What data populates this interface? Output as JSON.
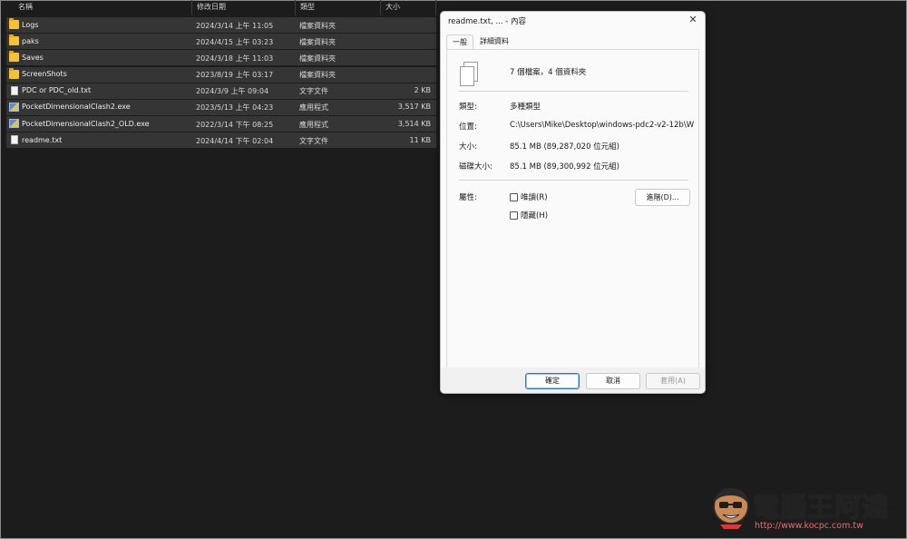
{
  "explorer": {
    "columns": {
      "name": "名稱",
      "date": "修改日期",
      "type": "類型",
      "size": "大小"
    },
    "files": [
      {
        "icon": "folder-icon",
        "name": "Logs",
        "date": "2024/3/14 上午 11:05",
        "type": "檔案資料夾",
        "size": ""
      },
      {
        "icon": "folder-icon",
        "name": "paks",
        "date": "2024/4/15 上午 03:23",
        "type": "檔案資料夾",
        "size": ""
      },
      {
        "icon": "folder-icon",
        "name": "Saves",
        "date": "2024/3/18 上午 11:03",
        "type": "檔案資料夾",
        "size": ""
      },
      {
        "icon": "folder-icon",
        "name": "ScreenShots",
        "date": "2023/8/19 上午 03:17",
        "type": "檔案資料夾",
        "size": ""
      },
      {
        "icon": "text-file-icon",
        "name": "PDC or PDC_old.txt",
        "date": "2024/3/9 上午 09:04",
        "type": "文字文件",
        "size": "2 KB"
      },
      {
        "icon": "exe-icon",
        "name": "PocketDimensionalClash2.exe",
        "date": "2023/5/13 上午 04:23",
        "type": "應用程式",
        "size": "3,517 KB"
      },
      {
        "icon": "exe-icon",
        "name": "PocketDimensionalClash2_OLD.exe",
        "date": "2022/3/14 下午 08:25",
        "type": "應用程式",
        "size": "3,514 KB"
      },
      {
        "icon": "text-file-icon",
        "name": "readme.txt",
        "date": "2024/4/14 下午 02:04",
        "type": "文字文件",
        "size": "11 KB"
      }
    ]
  },
  "dialog": {
    "title": "readme.txt, ... - 內容",
    "close": "✕",
    "tabs": [
      "一般",
      "詳細資料"
    ],
    "summary": "7 個檔案，4 個資料夾",
    "type_label": "類型:",
    "type_value": "多種類型",
    "location_label": "位置:",
    "location_value": "C:\\Users\\Mike\\Desktop\\windows-pdc2-v2-12b\\W",
    "size_label": "大小:",
    "size_value": "85.1 MB (89,287,020 位元組)",
    "disk_size_label": "磁碟大小:",
    "disk_size_value": "85.1 MB (89,300,992 位元組)",
    "attributes_label": "屬性:",
    "readonly_label": "唯讀(R)",
    "hidden_label": "隱藏(H)",
    "advanced_button": "進階(D)...",
    "ok_button": "確定",
    "cancel_button": "取消",
    "apply_button": "套用(A)"
  },
  "watermark": {
    "title": "電腦王阿達",
    "url": "http://www.kocpc.com.tw"
  }
}
